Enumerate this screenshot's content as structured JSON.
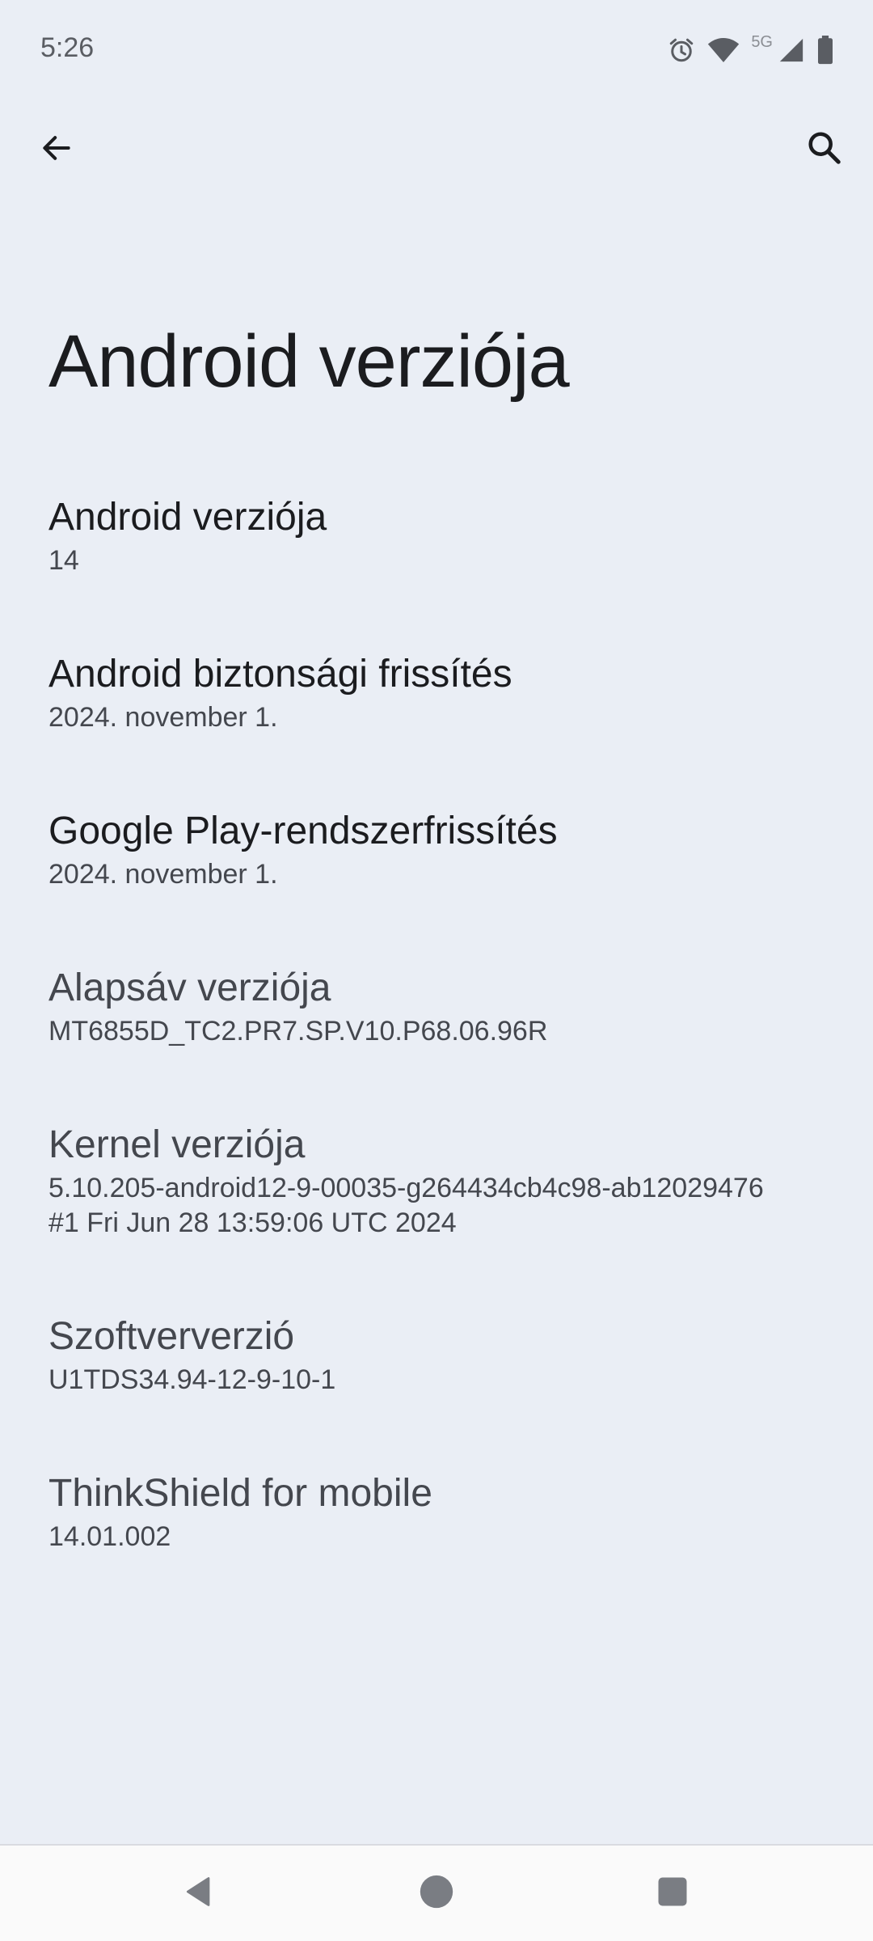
{
  "status_bar": {
    "time": "5:26",
    "network_label": "5G",
    "icons": [
      "alarm-icon",
      "wifi-icon",
      "signal-icon",
      "battery-icon"
    ]
  },
  "app_bar": {
    "back_icon": "arrow-back-icon",
    "search_icon": "search-icon"
  },
  "page": {
    "title": "Android verziója"
  },
  "items": [
    {
      "label": "Android verziója",
      "value": "14"
    },
    {
      "label": "Android biztonsági frissítés",
      "value": "2024. november 1."
    },
    {
      "label": "Google Play-rendszerfrissítés",
      "value": "2024. november 1."
    },
    {
      "label": "Alapsáv verziója",
      "value": "MT6855D_TC2.PR7.SP.V10.P68.06.96R"
    },
    {
      "label": "Kernel verziója",
      "value": "5.10.205-android12-9-00035-g264434cb4c98-ab12029476\n#1 Fri Jun 28 13:59:06 UTC 2024"
    },
    {
      "label": "Szoftververzió",
      "value": "U1TDS34.94-12-9-10-1"
    },
    {
      "label": "ThinkShield for mobile",
      "value": "14.01.002"
    }
  ],
  "nav_bar": {
    "icons": [
      "nav-back-icon",
      "nav-home-icon",
      "nav-recents-icon"
    ]
  },
  "colors": {
    "background": "#eaeef5",
    "text_primary": "#1b1c1f",
    "text_secondary": "#44474e"
  }
}
